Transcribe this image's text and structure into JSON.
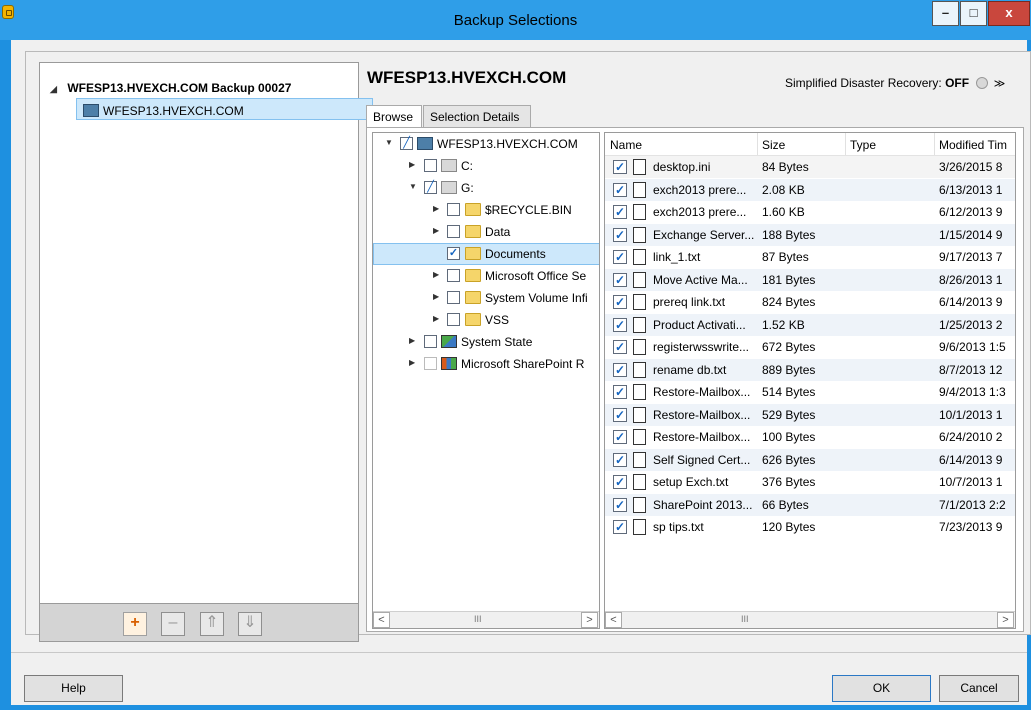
{
  "window": {
    "title": "Backup Selections",
    "min_label": "–",
    "max_label": "□",
    "close_label": "x"
  },
  "left_tree": {
    "root_label": "WFESP13.HVEXCH.COM Backup 00027",
    "child_label": "WFESP13.HVEXCH.COM"
  },
  "toolbar": {
    "add": "+",
    "remove": "–",
    "up": "⇑",
    "down": "⇓"
  },
  "host": {
    "title": "WFESP13.HVEXCH.COM"
  },
  "sdr": {
    "label": "Simplified Disaster Recovery:",
    "state": "OFF",
    "chevron": "≫"
  },
  "tabs": {
    "browse": "Browse",
    "details": "Selection Details"
  },
  "tree": {
    "items": [
      {
        "label": "WFESP13.HVEXCH.COM"
      },
      {
        "label": "C:"
      },
      {
        "label": "G:"
      },
      {
        "label": "$RECYCLE.BIN"
      },
      {
        "label": "Data"
      },
      {
        "label": "Documents"
      },
      {
        "label": "Microsoft Office Se"
      },
      {
        "label": "System Volume Infi"
      },
      {
        "label": "VSS"
      },
      {
        "label": "System State"
      },
      {
        "label": "Microsoft SharePoint R"
      }
    ]
  },
  "scroll": {
    "left": "<",
    "right": ">",
    "grip": "III"
  },
  "files": {
    "columns": {
      "name": "Name",
      "size": "Size",
      "type": "Type",
      "modified": "Modified Tim"
    },
    "rows": [
      {
        "name": "desktop.ini",
        "size": "84 Bytes",
        "modified": "3/26/2015 8"
      },
      {
        "name": "exch2013 prere...",
        "size": "2.08 KB",
        "modified": "6/13/2013 1"
      },
      {
        "name": "exch2013 prere...",
        "size": "1.60 KB",
        "modified": "6/12/2013 9"
      },
      {
        "name": "Exchange Server...",
        "size": "188 Bytes",
        "modified": "1/15/2014 9"
      },
      {
        "name": "link_1.txt",
        "size": "87 Bytes",
        "modified": "9/17/2013 7"
      },
      {
        "name": "Move Active Ma...",
        "size": "181 Bytes",
        "modified": "8/26/2013 1"
      },
      {
        "name": "prereq link.txt",
        "size": "824 Bytes",
        "modified": "6/14/2013 9"
      },
      {
        "name": "Product Activati...",
        "size": "1.52 KB",
        "modified": "1/25/2013 2"
      },
      {
        "name": "registerwsswrite...",
        "size": "672 Bytes",
        "modified": "9/6/2013 1:5"
      },
      {
        "name": "rename db.txt",
        "size": "889 Bytes",
        "modified": "8/7/2013 12"
      },
      {
        "name": "Restore-Mailbox...",
        "size": "514 Bytes",
        "modified": "9/4/2013 1:3"
      },
      {
        "name": "Restore-Mailbox...",
        "size": "529 Bytes",
        "modified": "10/1/2013 1"
      },
      {
        "name": "Restore-Mailbox...",
        "size": "100 Bytes",
        "modified": "6/24/2010 2"
      },
      {
        "name": "Self Signed Cert...",
        "size": "626 Bytes",
        "modified": "6/14/2013 9"
      },
      {
        "name": "setup Exch.txt",
        "size": "376 Bytes",
        "modified": "10/7/2013 1"
      },
      {
        "name": "SharePoint 2013...",
        "size": "66 Bytes",
        "modified": "7/1/2013 2:2"
      },
      {
        "name": "sp tips.txt",
        "size": "120 Bytes",
        "modified": "7/23/2013 9"
      }
    ]
  },
  "buttons": {
    "help": "Help",
    "ok": "OK",
    "cancel": "Cancel"
  }
}
